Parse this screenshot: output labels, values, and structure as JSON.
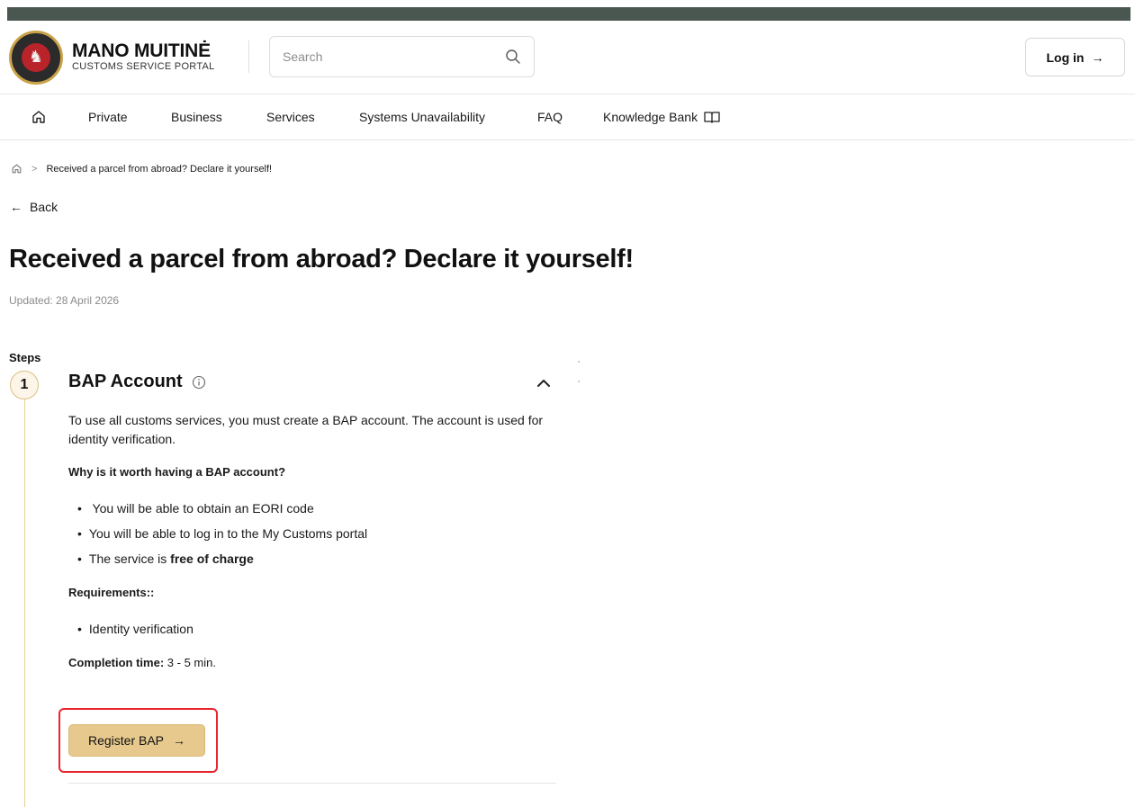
{
  "brand": {
    "name": "MANO MUITINĖ",
    "subtitle": "CUSTOMS SERVICE PORTAL"
  },
  "search": {
    "placeholder": "Search"
  },
  "header": {
    "login_label": "Log in",
    "login_arrow": "→"
  },
  "nav": {
    "items": [
      {
        "label": "Private"
      },
      {
        "label": "Business"
      },
      {
        "label": "Services"
      },
      {
        "label": "Systems Unavailability"
      },
      {
        "label": "FAQ"
      },
      {
        "label": "Knowledge Bank"
      }
    ]
  },
  "breadcrumb": {
    "separator": ">",
    "current": "Received a parcel from abroad? Declare it yourself!"
  },
  "back": {
    "arrow": "←",
    "label": "Back"
  },
  "page": {
    "title": "Received a parcel from abroad? Declare it yourself!",
    "updated": "Updated: 28 April 2026"
  },
  "steps": {
    "label": "Steps",
    "step1": {
      "number": "1",
      "title": "BAP Account",
      "intro": "To use all customs services, you must create a BAP account. The account is used for identity verification.",
      "why_heading": "Why is it worth having a BAP account?",
      "benefits": [
        {
          "text": " You will be able to obtain an EORI code"
        },
        {
          "text": "You will be able to log in to the My Customs portal"
        },
        {
          "text_prefix": "The service is ",
          "text_bold": "free of charge"
        }
      ],
      "requirements_heading": "Requirements::",
      "requirements": [
        {
          "text": "Identity verification"
        }
      ],
      "completion_label": "Completion time:",
      "completion_value": "3 - 5 min.",
      "cta_label": "Register BAP",
      "cta_arrow": "→"
    }
  },
  "colors": {
    "accent": "#e7c98e",
    "highlight": "#e8262e",
    "topbar": "#4a5650",
    "step_border": "#d8bf84"
  }
}
